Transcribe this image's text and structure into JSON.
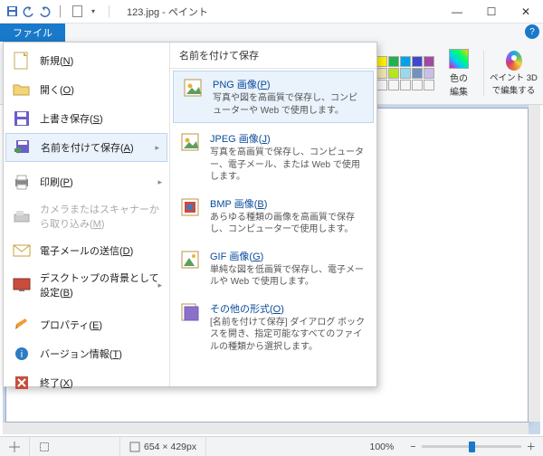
{
  "titlebar": {
    "title": "123.jpg - ペイント"
  },
  "win": {
    "min": "—",
    "max": "☐",
    "close": "✕"
  },
  "file_tab": "ファイル",
  "ribbon": {
    "color_edit": "色の\n編集",
    "paint3d_line1": "ペイント 3D",
    "paint3d_line2": "で編集する",
    "palette_colors": [
      "#000",
      "#7f7f7f",
      "#880015",
      "#ed1c24",
      "#ff7f27",
      "#fff200",
      "#22b14c",
      "#00a2e8",
      "#3f48cc",
      "#a349a4",
      "#fff",
      "#c3c3c3",
      "#b97a57",
      "#ffaec9",
      "#ffc90e",
      "#efe4b0",
      "#b5e61d",
      "#99d9ea",
      "#7092be",
      "#c8bfe7",
      "#f5f5f5",
      "#f5f5f5",
      "#f5f5f5",
      "#f5f5f5",
      "#f5f5f5",
      "#f5f5f5",
      "#f5f5f5",
      "#f5f5f5",
      "#f5f5f5",
      "#f5f5f5"
    ]
  },
  "menu_left": [
    {
      "label": "新規",
      "accel": "N",
      "icon": "new"
    },
    {
      "label": "開く",
      "accel": "O",
      "icon": "open"
    },
    {
      "label": "上書き保存",
      "accel": "S",
      "icon": "save"
    },
    {
      "label": "名前を付けて保存",
      "accel": "A",
      "icon": "saveas",
      "submenu": true,
      "selected": true
    },
    {
      "label": "印刷",
      "accel": "P",
      "icon": "print",
      "submenu": true
    },
    {
      "label": "カメラまたはスキャナーから取り込み",
      "accel": "M",
      "icon": "scanner",
      "disabled": true
    },
    {
      "label": "電子メールの送信",
      "accel": "D",
      "icon": "mail"
    },
    {
      "label": "デスクトップの背景として設定",
      "accel": "B",
      "icon": "desktop",
      "submenu": true
    },
    {
      "label": "プロパティ",
      "accel": "E",
      "icon": "props"
    },
    {
      "label": "バージョン情報",
      "accel": "T",
      "icon": "about"
    },
    {
      "label": "終了",
      "accel": "X",
      "icon": "exit"
    }
  ],
  "submenu": {
    "header": "名前を付けて保存",
    "items": [
      {
        "title": "PNG 画像",
        "accel": "P",
        "desc": "写真や図を高画質で保存し、コンピューターや Web で使用します。",
        "hl": true,
        "icon": "png"
      },
      {
        "title": "JPEG 画像",
        "accel": "J",
        "desc": "写真を高画質で保存し、コンピューター、電子メール、または Web で使用します。",
        "icon": "jpeg"
      },
      {
        "title": "BMP 画像",
        "accel": "B",
        "desc": "あらゆる種類の画像を高画質で保存し、コンピューターで使用します。",
        "icon": "bmp"
      },
      {
        "title": "GIF 画像",
        "accel": "G",
        "desc": "単純な図を低画質で保存し、電子メールや Web で使用します。",
        "icon": "gif"
      },
      {
        "title": "その他の形式",
        "accel": "O",
        "desc": "[名前を付けて保存] ダイアログ ボックスを開き、指定可能なすべてのファイルの種類から選択します。",
        "icon": "other"
      }
    ]
  },
  "status": {
    "dims": "654 × 429px",
    "zoom": "100%",
    "minus": "−",
    "plus": "＋"
  }
}
